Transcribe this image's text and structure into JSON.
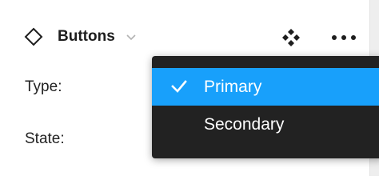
{
  "header": {
    "title": "Buttons",
    "icons": {
      "component": "component-diamond-icon",
      "chevron": "chevron-down-icon",
      "variant": "variant-diamonds-icon",
      "more": "more-horizontal-icon"
    }
  },
  "properties": [
    {
      "label": "Type:"
    },
    {
      "label": "State:"
    }
  ],
  "dropdown": {
    "items": [
      {
        "label": "Primary",
        "selected": true
      },
      {
        "label": "Secondary",
        "selected": false
      }
    ],
    "check_icon": "check-icon"
  },
  "colors": {
    "accent": "#18a0fb",
    "menu_background": "#222222",
    "menu_text": "#ffffff",
    "text": "#222222"
  }
}
